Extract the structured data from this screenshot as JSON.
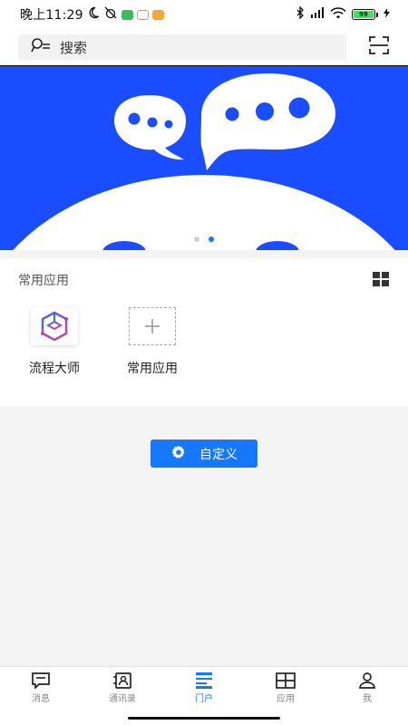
{
  "status_bar": {
    "time": "晚上11:29",
    "battery_level": "99"
  },
  "search": {
    "placeholder": "搜索"
  },
  "banner": {
    "slide_count": 2,
    "active_slide": 2,
    "background_color": "#1a4dff"
  },
  "apps": {
    "section_title": "常用应用",
    "items": [
      {
        "label": "流程大师",
        "icon": "process-master-logo"
      },
      {
        "label": "常用应用",
        "icon": "add-icon"
      }
    ]
  },
  "customize": {
    "label": "自定义",
    "icon": "gear-icon"
  },
  "nav": {
    "items": [
      {
        "label": "消息",
        "icon": "message-icon"
      },
      {
        "label": "通讯录",
        "icon": "contacts-icon"
      },
      {
        "label": "门户",
        "icon": "portal-icon",
        "active": true
      },
      {
        "label": "应用",
        "icon": "apps-grid-icon"
      },
      {
        "label": "我",
        "icon": "person-icon"
      }
    ]
  },
  "colors": {
    "accent": "#1677ff",
    "banner_blue": "#1a4dff"
  }
}
